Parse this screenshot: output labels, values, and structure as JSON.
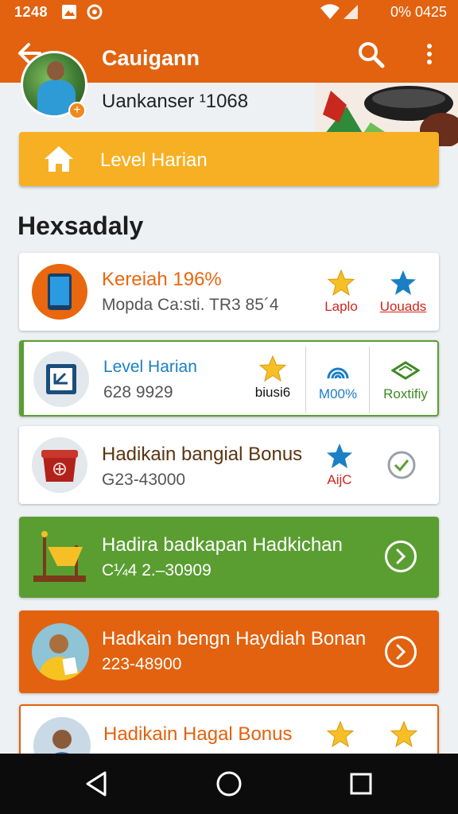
{
  "status": {
    "time": "1248",
    "battery_text": "0% 0425"
  },
  "header": {
    "title": "Cauigann",
    "username": "Uankanser ¹1068"
  },
  "level_banner": {
    "label": "Level Harian"
  },
  "section": {
    "title": "Hexsadaly"
  },
  "cards": [
    {
      "title": "Kereiah 196%",
      "sub": "Mopda Ca:sti. TR3 85´4",
      "actions": [
        {
          "label": "Laplo"
        },
        {
          "label": "Uouads"
        }
      ]
    },
    {
      "title": "Level Harian",
      "sub": "628 9929",
      "actions": [
        {
          "label": "biusi6"
        },
        {
          "label": "M00%"
        },
        {
          "label": "Roxtifiy"
        }
      ]
    },
    {
      "title": "Hadikain bangial Bonus",
      "sub": "G23-43000",
      "actions": [
        {
          "label": "AijC"
        }
      ]
    },
    {
      "title": "Hadira badkapan Hadkichan",
      "sub": "C¼4 2.–30909"
    },
    {
      "title": "Hadkain bengn Haydiah Bonan",
      "sub": "223-48900"
    },
    {
      "title": "Hadikain Hagal Bonus"
    }
  ],
  "colors": {
    "orange": "#e2620f",
    "yellow": "#f7b024",
    "green": "#5a9e32",
    "blue": "#1a7fc4"
  }
}
